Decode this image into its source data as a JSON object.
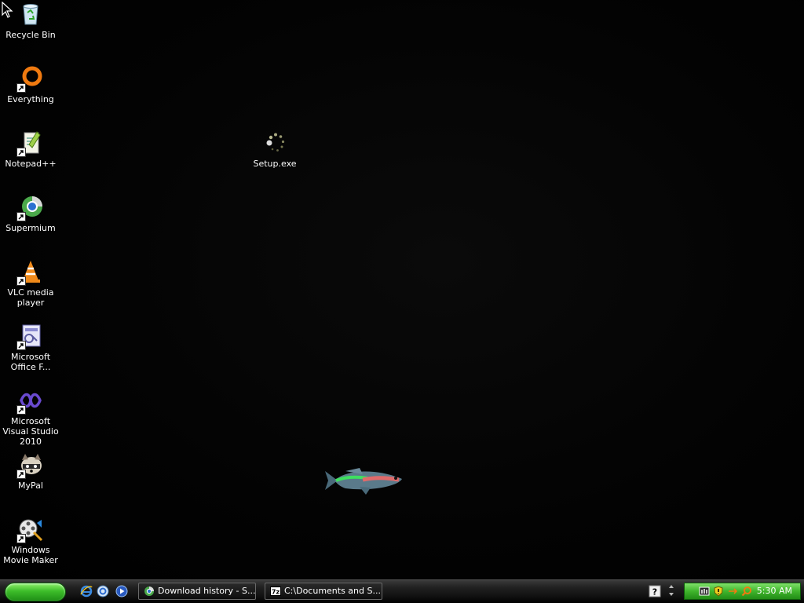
{
  "desktop": {
    "icons": [
      {
        "name": "recycle-bin-icon",
        "label": "Recycle Bin"
      },
      {
        "name": "everything-icon",
        "label": "Everything"
      },
      {
        "name": "notepad-plus-plus-icon",
        "label": "Notepad++"
      },
      {
        "name": "supermium-icon",
        "label": "Supermium"
      },
      {
        "name": "vlc-icon",
        "label": "VLC media player"
      },
      {
        "name": "office-forms-icon",
        "label": "Microsoft Office F..."
      },
      {
        "name": "visual-studio-icon",
        "label": "Microsoft Visual Studio 2010"
      },
      {
        "name": "mypal-icon",
        "label": "MyPal"
      },
      {
        "name": "movie-maker-icon",
        "label": "Windows Movie Maker"
      },
      {
        "name": "setup-exe-icon",
        "label": "Setup.exe"
      }
    ]
  },
  "taskbar": {
    "quick_launch": [
      "internet-explorer-icon",
      "show-desktop-icon",
      "media-player-icon"
    ],
    "tasks": [
      {
        "name": "task-download-history",
        "label": "Download history - S...",
        "icon": "supermium-icon"
      },
      {
        "name": "task-documents-7zip",
        "label": "C:\\Documents and S...",
        "icon": "7zip-icon"
      }
    ],
    "tray": {
      "icons": [
        "network-icon",
        "security-shield-icon",
        "tray-arrow-icon",
        "search-icon"
      ],
      "clock": "5:30 AM"
    }
  },
  "colors": {
    "start_green": "#3dbd2a",
    "tray_green": "#3fb52c",
    "desktop_bg": "#000000"
  }
}
